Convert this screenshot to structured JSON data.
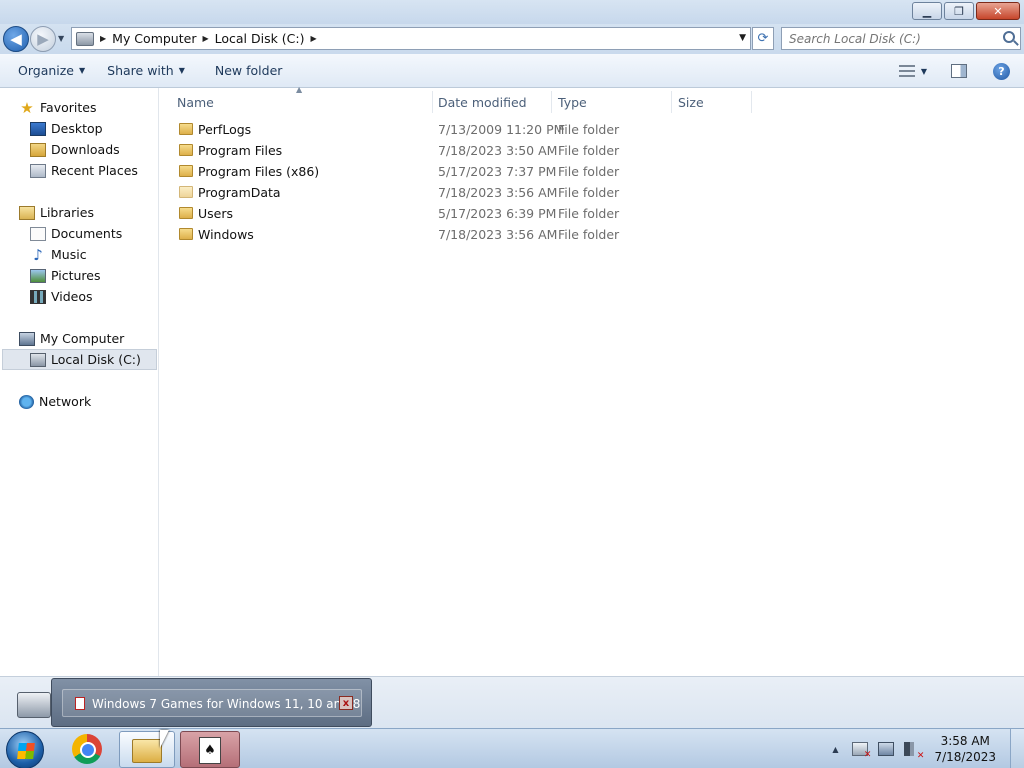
{
  "window": {
    "controls": {
      "minimize": "▁",
      "maximize": "❐",
      "close": "✕"
    }
  },
  "address": {
    "breadcrumbs": [
      "My Computer",
      "Local Disk (C:)"
    ],
    "separator": "▶",
    "search_placeholder": "Search Local Disk (C:)"
  },
  "toolbar": {
    "organize": "Organize",
    "share_with": "Share with",
    "new_folder": "New folder",
    "caret": "▼"
  },
  "sidebar": {
    "favorites": {
      "label": "Favorites",
      "icon": "star-icon"
    },
    "favorites_items": [
      {
        "label": "Desktop",
        "icon": "desktop-icon"
      },
      {
        "label": "Downloads",
        "icon": "downloads-icon"
      },
      {
        "label": "Recent Places",
        "icon": "recent-places-icon"
      }
    ],
    "libraries": {
      "label": "Libraries",
      "icon": "libraries-icon"
    },
    "libraries_items": [
      {
        "label": "Documents",
        "icon": "documents-icon"
      },
      {
        "label": "Music",
        "icon": "music-icon"
      },
      {
        "label": "Pictures",
        "icon": "pictures-icon"
      },
      {
        "label": "Videos",
        "icon": "videos-icon"
      }
    ],
    "computer": {
      "label": "My Computer",
      "icon": "computer-icon"
    },
    "computer_items": [
      {
        "label": "Local Disk (C:)",
        "icon": "drive-icon",
        "selected": true
      }
    ],
    "network": {
      "label": "Network",
      "icon": "network-icon"
    }
  },
  "columns": {
    "name": "Name",
    "date_modified": "Date modified",
    "type": "Type",
    "size": "Size"
  },
  "files": [
    {
      "name": "PerfLogs",
      "date": "7/13/2009 11:20 PM",
      "type": "File folder"
    },
    {
      "name": "Program Files",
      "date": "7/18/2023 3:50 AM",
      "type": "File folder"
    },
    {
      "name": "Program Files (x86)",
      "date": "5/17/2023 7:37 PM",
      "type": "File folder"
    },
    {
      "name": "ProgramData",
      "date": "7/18/2023 3:56 AM",
      "type": "File folder"
    },
    {
      "name": "Users",
      "date": "5/17/2023 6:39 PM",
      "type": "File folder"
    },
    {
      "name": "Windows",
      "date": "7/18/2023 3:56 AM",
      "type": "File folder"
    }
  ],
  "taskbar": {
    "preview_title": "Windows 7 Games for Windows 11, 10 and 8",
    "preview_close": "x",
    "solitaire_glyph": "♠",
    "clock_time": "3:58 AM",
    "clock_date": "7/18/2023",
    "tray_up": "▲"
  }
}
